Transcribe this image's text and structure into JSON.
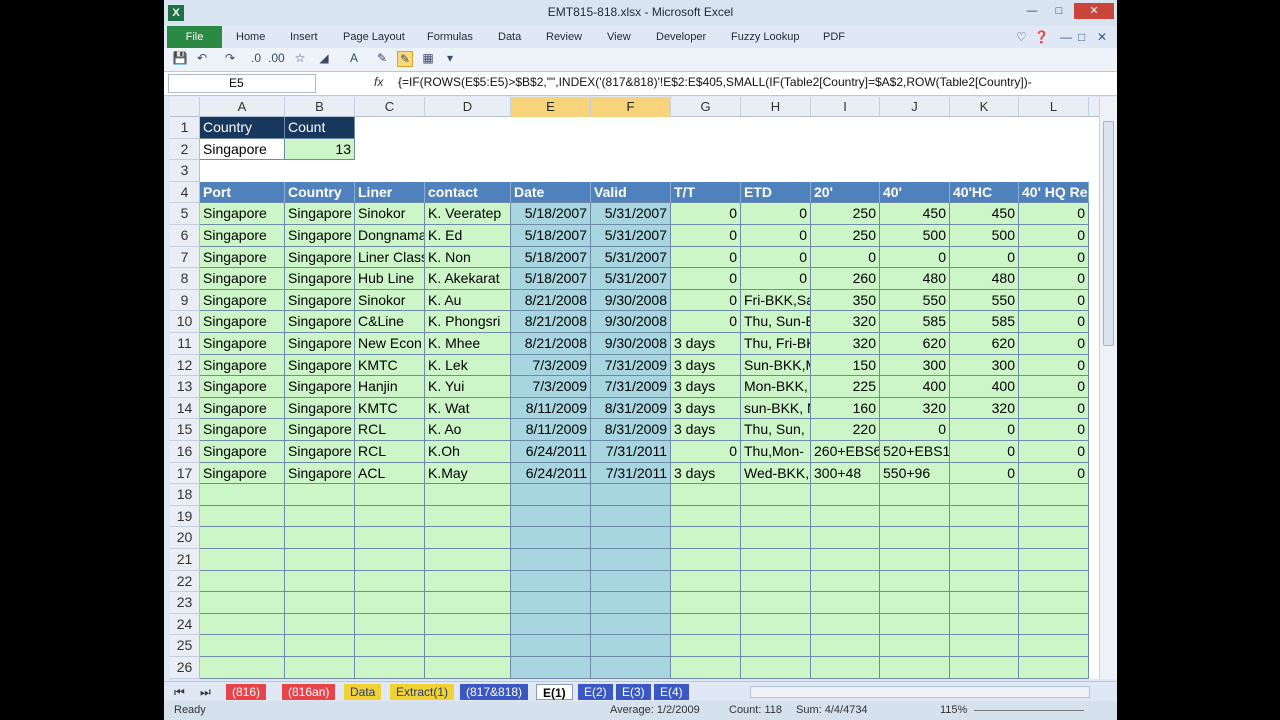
{
  "window": {
    "title": "EMT815-818.xlsx - Microsoft Excel",
    "app_icon": "X"
  },
  "ribbon": {
    "file": "File",
    "tabs": [
      "Home",
      "Insert",
      "Page Layout",
      "Formulas",
      "Data",
      "Review",
      "View",
      "Developer",
      "Fuzzy Lookup",
      "PDF"
    ]
  },
  "formula_bar": {
    "name_box": "E5",
    "fx": "fx",
    "formula": "{=IF(ROWS(E$5:E5)>$B$2,\"\",INDEX('(817&818)'!E$2:E$405,SMALL(IF(Table2[Country]=$A$2,ROW(Table2[Country])-"
  },
  "columns": [
    "A",
    "B",
    "C",
    "D",
    "E",
    "F",
    "G",
    "H",
    "I",
    "J",
    "K",
    "L"
  ],
  "summary": {
    "h1": "Country",
    "h2": "Count",
    "country": "Singapore",
    "count": "13"
  },
  "table": {
    "headers": [
      "Port",
      "Country",
      "Liner",
      "contact",
      "Date",
      "Valid",
      "T/T",
      "ETD",
      "20'",
      "40'",
      "40'HC",
      "40' HQ Re"
    ],
    "rows": [
      [
        "Singapore",
        "Singapore",
        "Sinokor",
        "K. Veeratep",
        "5/18/2007",
        "5/31/2007",
        "0",
        "0",
        "250",
        "450",
        "450",
        "0"
      ],
      [
        "Singapore",
        "Singapore",
        "Dongnama",
        "K. Ed",
        "5/18/2007",
        "5/31/2007",
        "0",
        "0",
        "250",
        "500",
        "500",
        "0"
      ],
      [
        "Singapore",
        "Singapore",
        "Liner Class",
        "K. Non",
        "5/18/2007",
        "5/31/2007",
        "0",
        "0",
        "0",
        "0",
        "0",
        "0"
      ],
      [
        "Singapore",
        "Singapore",
        "Hub Line",
        "K. Akekarat",
        "5/18/2007",
        "5/31/2007",
        "0",
        "0",
        "260",
        "480",
        "480",
        "0"
      ],
      [
        "Singapore",
        "Singapore",
        "Sinokor",
        "K. Au",
        "8/21/2008",
        "9/30/2008",
        "0",
        "Fri-BKK,Sa",
        "350",
        "550",
        "550",
        "0"
      ],
      [
        "Singapore",
        "Singapore",
        "C&Line",
        "K. Phongsri",
        "8/21/2008",
        "9/30/2008",
        "0",
        "Thu, Sun-E",
        "320",
        "585",
        "585",
        "0"
      ],
      [
        "Singapore",
        "Singapore",
        "New Econ",
        "K. Mhee",
        "8/21/2008",
        "9/30/2008",
        "3 days",
        "Thu, Fri-BK",
        "320",
        "620",
        "620",
        "0"
      ],
      [
        "Singapore",
        "Singapore",
        "KMTC",
        "K. Lek",
        "7/3/2009",
        "7/31/2009",
        "3 days",
        "Sun-BKK,M",
        "150",
        "300",
        "300",
        "0"
      ],
      [
        "Singapore",
        "Singapore",
        "Hanjin",
        "K. Yui",
        "7/3/2009",
        "7/31/2009",
        "3 days",
        "Mon-BKK,",
        "225",
        "400",
        "400",
        "0"
      ],
      [
        "Singapore",
        "Singapore",
        "KMTC",
        "K. Wat",
        "8/11/2009",
        "8/31/2009",
        "3 days",
        "sun-BKK, M",
        "160",
        "320",
        "320",
        "0"
      ],
      [
        "Singapore",
        "Singapore",
        "RCL",
        "K. Ao",
        "8/11/2009",
        "8/31/2009",
        "3 days",
        "Thu, Sun,",
        "220",
        "0",
        "0",
        "0"
      ],
      [
        "Singapore",
        "Singapore",
        "RCL",
        "K.Oh",
        "6/24/2011",
        "7/31/2011",
        "0",
        "Thu,Mon-",
        "260+EBS6",
        "520+EBS1",
        "0",
        "0"
      ],
      [
        "Singapore",
        "Singapore",
        "ACL",
        "K.May",
        "6/24/2011",
        "7/31/2011",
        "3 days",
        "Wed-BKK,",
        "300+48",
        "550+96",
        "0",
        "0"
      ]
    ]
  },
  "row_numbers": [
    "1",
    "2",
    "3",
    "4",
    "5",
    "6",
    "7",
    "8",
    "9",
    "10",
    "11",
    "12",
    "13",
    "14",
    "15",
    "16",
    "17",
    "18",
    "19",
    "20",
    "21",
    "22",
    "23",
    "24",
    "25",
    "26"
  ],
  "sheets": [
    "(816)",
    "(816an)",
    "Data",
    "Extract(1)",
    "(817&818)",
    "E(1)",
    "E(2)",
    "E(3)",
    "E(4)"
  ],
  "active_sheet": "E(1)",
  "status": {
    "ready": "Ready",
    "average": "Average: 1/2/2009",
    "count": "Count: 118",
    "sum": "Sum: 4/4/4734",
    "zoom": "115%"
  }
}
